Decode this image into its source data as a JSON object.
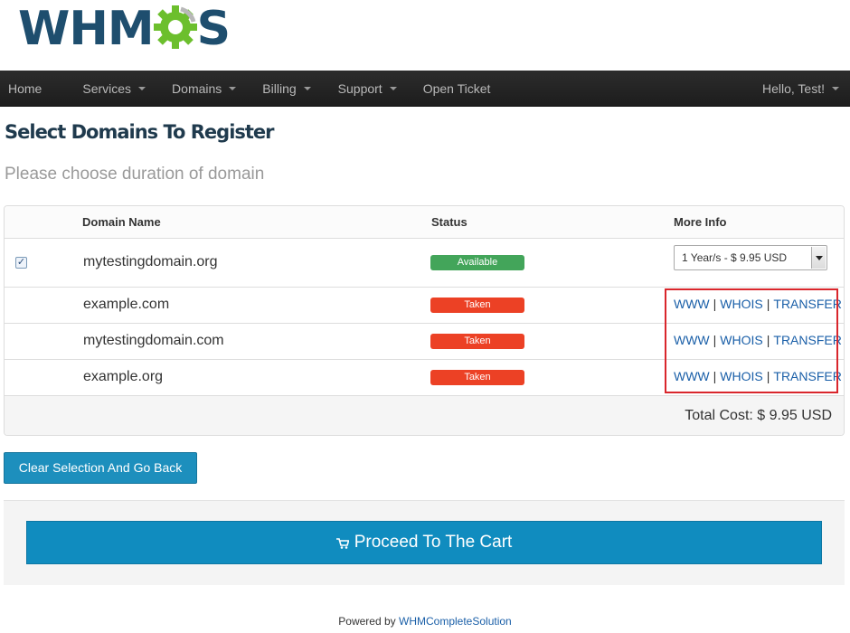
{
  "brand": {
    "logo_left": "WHM",
    "logo_right": "S",
    "logo_color": "#1e4e6e",
    "gear_color": "#6cbf2d"
  },
  "navbar": {
    "items": [
      {
        "label": "Home",
        "dropdown": false
      },
      {
        "label": "Services",
        "dropdown": true
      },
      {
        "label": "Domains",
        "dropdown": true
      },
      {
        "label": "Billing",
        "dropdown": true
      },
      {
        "label": "Support",
        "dropdown": true
      },
      {
        "label": "Open Ticket",
        "dropdown": false
      }
    ],
    "user_greeting": "Hello, Test!"
  },
  "page": {
    "title": "Select Domains To Register",
    "subtitle": "Please choose duration of domain"
  },
  "table": {
    "headers": {
      "domain": "Domain Name",
      "status": "Status",
      "more_info": "More Info"
    },
    "rows": [
      {
        "checked": true,
        "domain": "mytestingdomain.org",
        "status": "Available",
        "status_color": "#43a55a",
        "duration": "1 Year/s - $ 9.95 USD"
      },
      {
        "domain": "example.com",
        "status": "Taken",
        "status_color": "#ec4125",
        "links": [
          "WWW",
          "WHOIS",
          "TRANSFER"
        ]
      },
      {
        "domain": "mytestingdomain.com",
        "status": "Taken",
        "status_color": "#ec4125",
        "links": [
          "WWW",
          "WHOIS",
          "TRANSFER"
        ]
      },
      {
        "domain": "example.org",
        "status": "Taken",
        "status_color": "#ec4125",
        "links": [
          "WWW",
          "WHOIS",
          "TRANSFER"
        ]
      }
    ],
    "link_separator": "|",
    "total": "Total Cost: $ 9.95 USD"
  },
  "buttons": {
    "back": "Clear Selection And Go Back",
    "cart": "Proceed To The Cart"
  },
  "footer": {
    "prefix": "Powered by",
    "link": "WHMCompleteSolution"
  },
  "colors": {
    "accent": "#108cbf",
    "navbar": "#2c2c2c",
    "highlight": "#d9262c"
  }
}
